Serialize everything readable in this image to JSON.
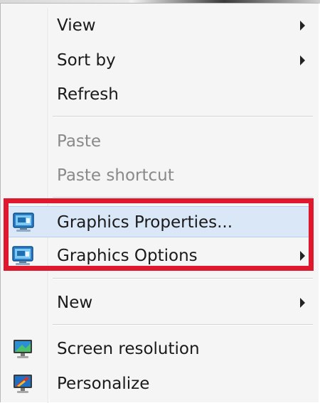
{
  "context_menu": {
    "items": [
      {
        "label": "View",
        "has_submenu": true,
        "enabled": true
      },
      {
        "label": "Sort by",
        "has_submenu": true,
        "enabled": true
      },
      {
        "label": "Refresh",
        "has_submenu": false,
        "enabled": true
      },
      {
        "label": "Paste",
        "has_submenu": false,
        "enabled": false
      },
      {
        "label": "Paste shortcut",
        "has_submenu": false,
        "enabled": false
      },
      {
        "label": "Graphics Properties...",
        "has_submenu": false,
        "enabled": true,
        "icon": "intel-graphics-icon",
        "hovered": true
      },
      {
        "label": "Graphics Options",
        "has_submenu": true,
        "enabled": true,
        "icon": "intel-graphics-icon"
      },
      {
        "label": "New",
        "has_submenu": true,
        "enabled": true
      },
      {
        "label": "Screen resolution",
        "has_submenu": false,
        "enabled": true,
        "icon": "screen-resolution-icon"
      },
      {
        "label": "Personalize",
        "has_submenu": false,
        "enabled": true,
        "icon": "personalize-icon"
      }
    ]
  },
  "colors": {
    "highlight_border": "#e0182d",
    "hover_background": "#d9e7f7",
    "disabled_text": "#8a8a8a"
  }
}
